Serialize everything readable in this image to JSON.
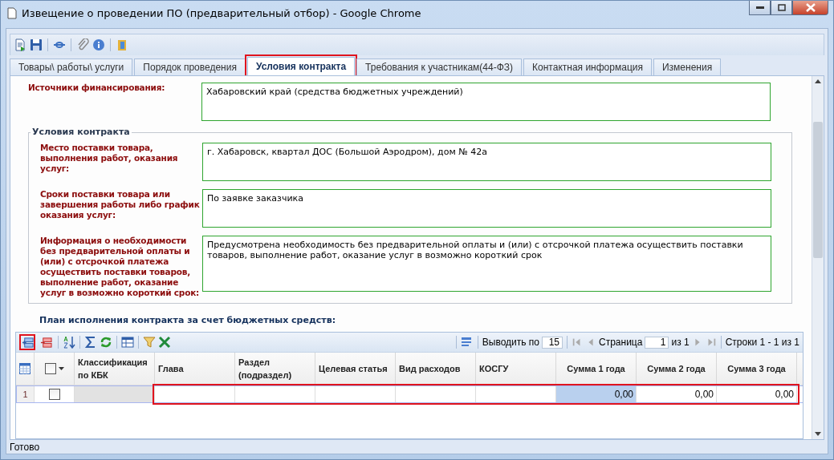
{
  "window": {
    "title": "Извещение о проведении ПО (предварительный отбор) - Google Chrome"
  },
  "tabs": [
    {
      "label": "Товары\\ работы\\ услуги",
      "selected": false,
      "highlighted": false
    },
    {
      "label": "Порядок проведения",
      "selected": false,
      "highlighted": false
    },
    {
      "label": "Условия контракта",
      "selected": true,
      "highlighted": true
    },
    {
      "label": "Требования к участникам(44-ФЗ)",
      "selected": false,
      "highlighted": false
    },
    {
      "label": "Контактная информация",
      "selected": false,
      "highlighted": false
    },
    {
      "label": "Изменения",
      "selected": false,
      "highlighted": false
    }
  ],
  "funding": {
    "label": "Источники финансирования:",
    "value": "Хабаровский край (средства бюджетных учреждений)"
  },
  "contract_terms": {
    "legend": "Условия контракта",
    "fields": [
      {
        "label": "Место поставки товара, выполнения работ, оказания услуг:",
        "value": "г. Хабаровск, квартал ДОС (Большой Аэродром), дом № 42а"
      },
      {
        "label": "Сроки поставки товара или завершения работы либо график оказания услуг:",
        "value": "По заявке заказчика"
      },
      {
        "label": "Информация о необходимости без предварительной оплаты и (или) с отсрочкой платежа осуществить поставки товаров, выполнение работ, оказание услуг в возможно короткий срок:",
        "value": "Предусмотрена необходимость без предварительной оплаты и (или) с отсрочкой платежа осуществить поставки товаров, выполнение работ, оказание услуг в возможно короткий срок"
      }
    ]
  },
  "plan": {
    "title": "План исполнения контракта за счет бюджетных средств:",
    "add_row_highlighted": true,
    "select_all_checked": false,
    "pager": {
      "page_size_label": "Выводить по",
      "page_size": "15",
      "page_label": "Страница",
      "page": "1",
      "page_total": "из 1",
      "rows_info": "Строки 1 - 1 из 1"
    },
    "columns": [
      "Классификация по КБК",
      "Глава",
      "Раздел (подраздел)",
      "Целевая статья",
      "Вид расходов",
      "КОСГУ",
      "Сумма 1 года",
      "Сумма 2 года",
      "Сумма 3 года"
    ],
    "rows": [
      {
        "number": "1",
        "checked": false,
        "highlighted": true,
        "sums": [
          {
            "text": "0,00",
            "selected": true
          },
          {
            "text": "0,00",
            "selected": false
          },
          {
            "text": "0,00",
            "selected": false
          }
        ]
      }
    ]
  },
  "status_bar": "Готово"
}
